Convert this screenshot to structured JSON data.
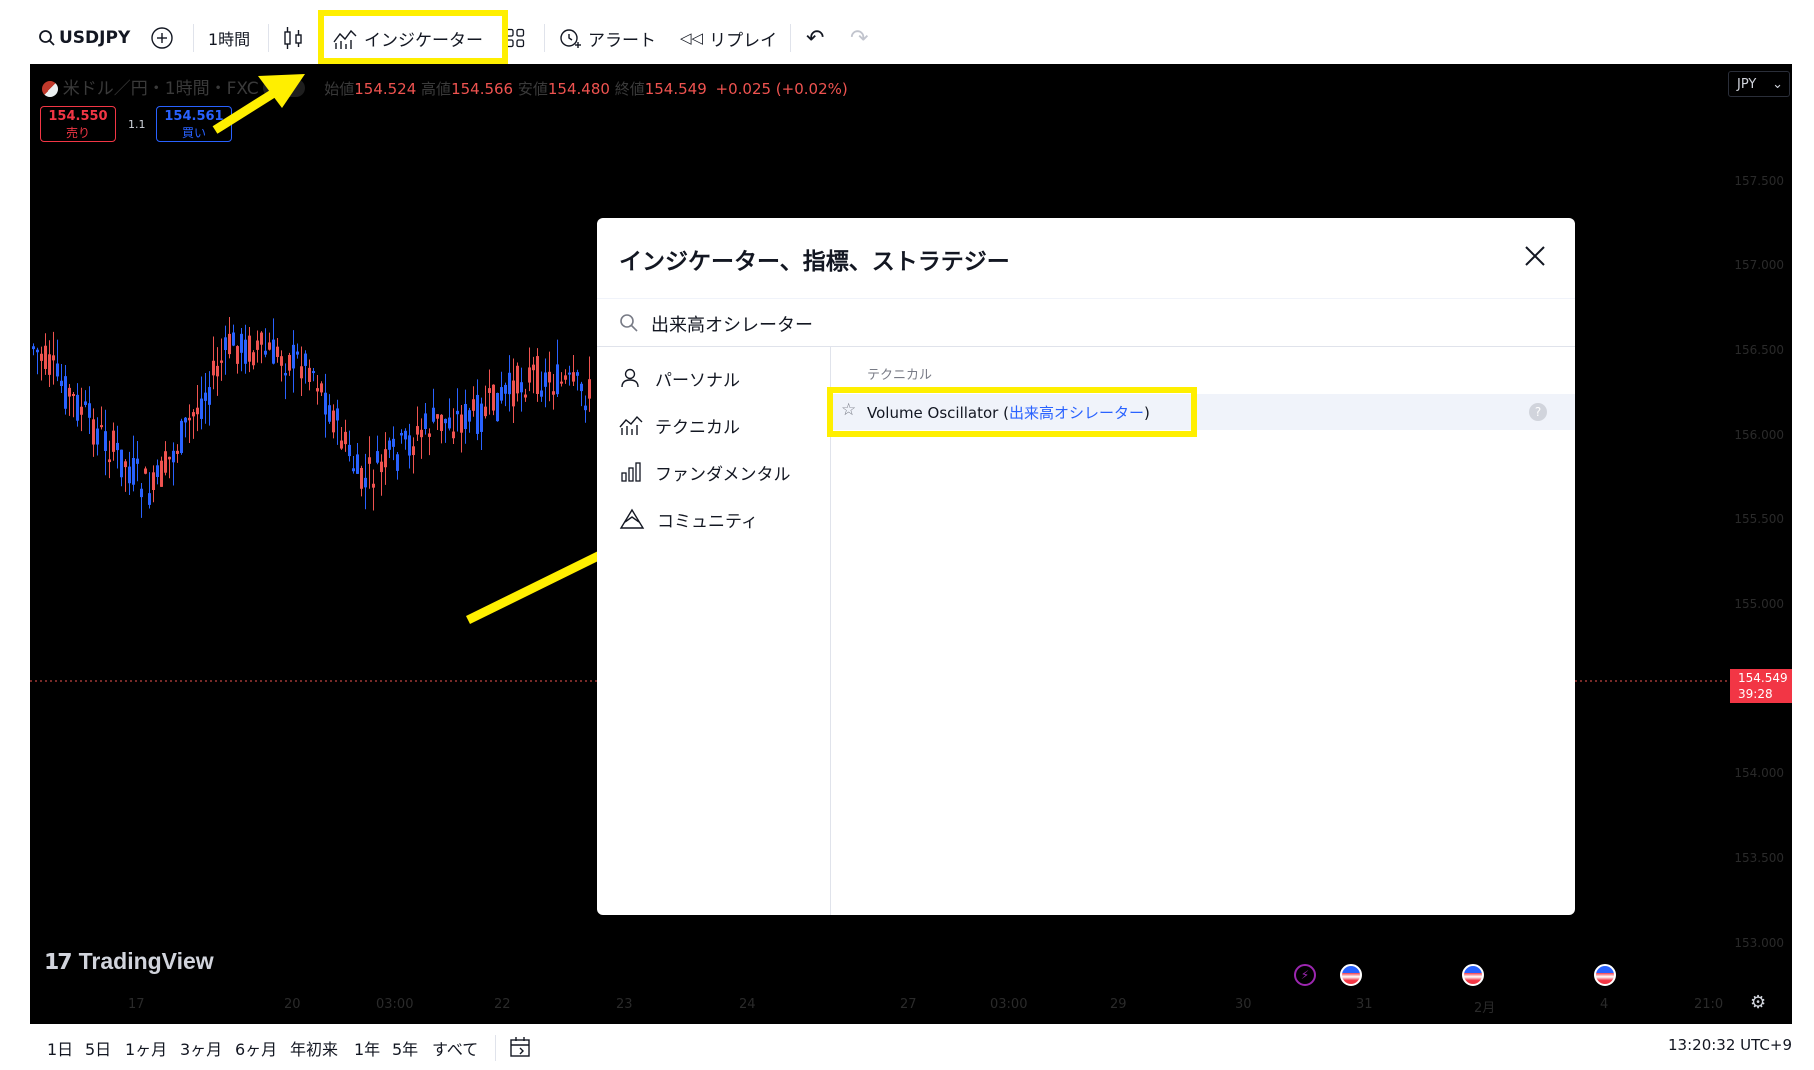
{
  "toolbar": {
    "symbol": "USDJPY",
    "interval": "1時間",
    "indicators_label": "インジケーター",
    "alert_label": "アラート",
    "replay_label": "リプレイ"
  },
  "chart": {
    "title": "米ドル／円・1時間・FXC",
    "legend": {
      "open_label": "始値",
      "open": "154.524",
      "high_label": "高値",
      "high": "154.566",
      "low_label": "安値",
      "low": "154.480",
      "close_label": "終値",
      "close": "154.549",
      "change": "+0.025 (+0.02%)"
    },
    "sell": {
      "price": "154.550",
      "label": "売り"
    },
    "spread": "1.1",
    "buy": {
      "price": "154.561",
      "label": "買い"
    },
    "currency": "JPY",
    "price_axis": [
      "157.500",
      "157.000",
      "156.500",
      "156.000",
      "155.500",
      "155.000",
      "154.000",
      "153.500",
      "153.000"
    ],
    "current_price": "154.549",
    "countdown": "39:28",
    "time_axis": [
      "17",
      "20",
      "03:00",
      "22",
      "23",
      "24",
      "27",
      "03:00",
      "29",
      "30",
      "31",
      "2月",
      "4",
      "21:0"
    ],
    "brand": "TradingView",
    "colors": {
      "up": "#ef5350",
      "down": "#2962ff",
      "highlight": "#ffef00",
      "background": "#000000"
    }
  },
  "modal": {
    "title": "インジケーター、指標、ストラテジー",
    "search_value": "出来高オシレーター",
    "categories": [
      {
        "icon": "user-icon",
        "label": "パーソナル"
      },
      {
        "icon": "technicals-icon",
        "label": "テクニカル"
      },
      {
        "icon": "bar-chart-icon",
        "label": "ファンダメンタル"
      },
      {
        "icon": "community-icon",
        "label": "コミュニティ"
      }
    ],
    "section_header": "テクニカル",
    "result": {
      "name": "Volume Oscillator",
      "open_paren": "(",
      "translated": "出来高オシレーター",
      "close_paren": ")"
    }
  },
  "bottom": {
    "ranges": [
      "1日",
      "5日",
      "1ヶ月",
      "3ヶ月",
      "6ヶ月",
      "年初来",
      "1年",
      "5年",
      "すべて"
    ],
    "clock": "13:20:32 UTC+9"
  }
}
